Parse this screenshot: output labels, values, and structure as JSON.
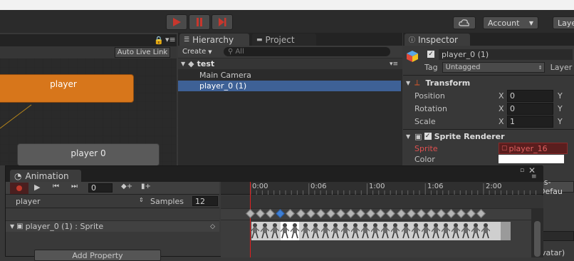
{
  "toolbar": {
    "play_icon": "play-icon",
    "pause_icon": "pause-icon",
    "step_icon": "step-icon",
    "cloud_icon": "cloud-icon",
    "account_label": "Account",
    "layers_label": "Layer",
    "accent": "#c8372d"
  },
  "animator": {
    "auto_live_link": "Auto Live Link",
    "node_player": "player",
    "node_player0": "player 0",
    "default_state_color": "#d7761b"
  },
  "hierarchy": {
    "tab_label": "Hierarchy",
    "project_tab_label": "Project",
    "create_label": "Create",
    "search_placeholder": "All",
    "scene_name": "test",
    "items": [
      {
        "label": "Main Camera",
        "selected": false
      },
      {
        "label": "player_0 (1)",
        "selected": true
      }
    ]
  },
  "inspector": {
    "tab_label": "Inspector",
    "object_name": "player_0 (1)",
    "tag_label": "Tag",
    "tag_value": "Untagged",
    "layer_label": "Layer",
    "transform": {
      "title": "Transform",
      "rows": [
        {
          "label": "Position",
          "axis": "X",
          "value": "0",
          "next_axis": "Y"
        },
        {
          "label": "Rotation",
          "axis": "X",
          "value": "0",
          "next_axis": "Y"
        },
        {
          "label": "Scale",
          "axis": "X",
          "value": "1",
          "next_axis": "Y"
        }
      ]
    },
    "sprite_renderer": {
      "title": "Sprite Renderer",
      "sprite_label": "Sprite",
      "sprite_value": "player_16",
      "color_label": "Color",
      "material_partial": "es-Defau",
      "partial_y": "Y",
      "avatar_partial": "vatar)"
    }
  },
  "animation": {
    "tab_label": "Animation",
    "frame_value": "0",
    "clip_name": "player",
    "samples_label": "Samples",
    "samples_value": "12",
    "property_label": "player_0 (1) : Sprite",
    "add_property_label": "Add Property",
    "timeline_labels": [
      "0:00",
      "0:06",
      "1:00",
      "1:06",
      "2:00"
    ],
    "keyframe_count": 24,
    "selected_keyframe": 3
  }
}
